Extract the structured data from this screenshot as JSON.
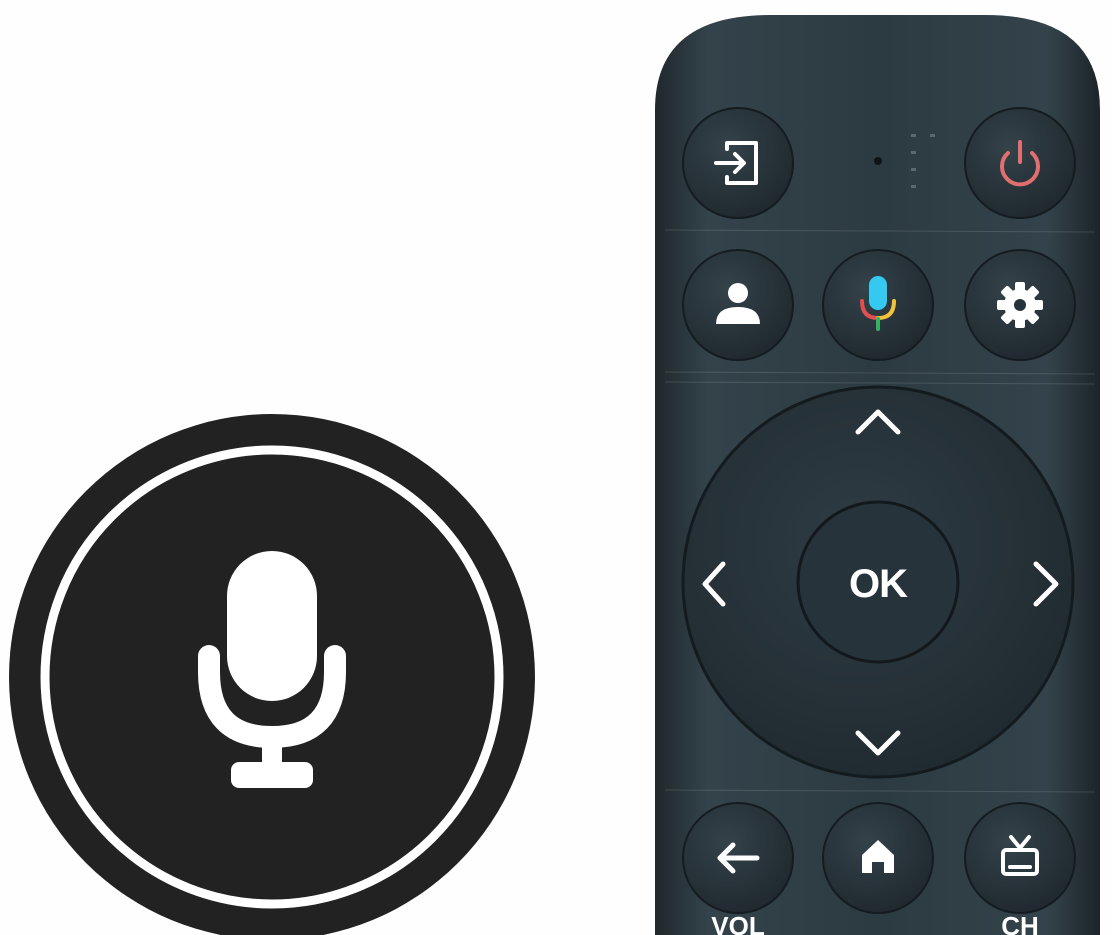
{
  "scene": {
    "background_color": "#ffffff",
    "remote_body_color": "#2e3b42",
    "button_color": "#26323a",
    "icon_color": "#ffffff",
    "power_icon_color": "#e07070",
    "mic_emblem_color": "#222222"
  },
  "remote": {
    "ok_label": "OK",
    "vol_label": "VOL",
    "ch_label": "CH",
    "buttons": [
      {
        "icon": "input-icon"
      },
      {
        "icon": "power-icon"
      },
      {
        "icon": "profile-icon"
      },
      {
        "icon": "google-assistant-mic-icon"
      },
      {
        "icon": "settings-gear-icon"
      },
      {
        "icon": "back-arrow-icon"
      },
      {
        "icon": "home-icon"
      },
      {
        "icon": "live-tv-icon"
      }
    ],
    "dpad_arrows": [
      "chevron-up-icon",
      "chevron-left-icon",
      "chevron-right-icon",
      "chevron-down-icon"
    ]
  },
  "emblem": {
    "icon": "microphone-icon"
  }
}
